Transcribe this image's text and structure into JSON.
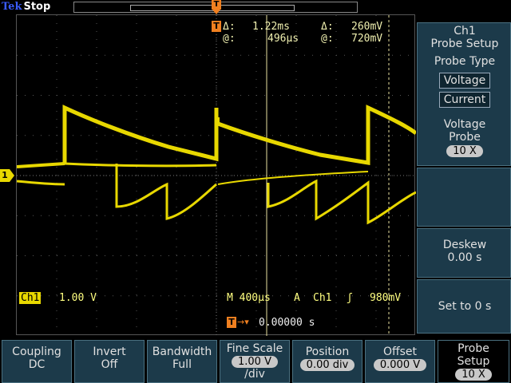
{
  "status": {
    "brand": "Tek",
    "acq_state": "Stop"
  },
  "record_view": {
    "trigger_marker": "T"
  },
  "cursor_readout": {
    "t_marker": "T",
    "time_delta_label": "Δ:",
    "time_delta": "1.22ms",
    "time_at_label": "@:",
    "time_at": "496µs",
    "volt_delta_label": "Δ:",
    "volt_delta": "260mV",
    "volt_at_label": "@:",
    "volt_at": "720mV"
  },
  "channel": {
    "marker": "1",
    "tag": "Ch1",
    "scale": "1.00 V",
    "color": "#e8d800"
  },
  "timebase": {
    "horizontal": "M 400µs",
    "trigger_mode": "A",
    "trigger_source": "Ch1",
    "slope_icon": "rising-edge-icon",
    "slope_glyph": "ʃ",
    "trigger_level": "980mV",
    "trigger_marker": "T",
    "trigger_arrow": "→▾",
    "trigger_position": "0.00000 s"
  },
  "side_menu": {
    "header": [
      "Ch1",
      "Probe Setup"
    ],
    "probe_type_label": "Probe Type",
    "probe_type_options": [
      "Voltage",
      "Current"
    ],
    "voltage_probe_label": [
      "Voltage",
      "Probe"
    ],
    "voltage_probe_value": "10 X",
    "deskew_label": "Deskew",
    "deskew_value": "0.00 s",
    "set_to_zero_label": "Set to 0 s"
  },
  "bottom_menu": [
    {
      "label": "Coupling",
      "value": "DC",
      "pill": false
    },
    {
      "label": "Invert",
      "value": "Off",
      "pill": false
    },
    {
      "label": "Bandwidth",
      "value": "Full",
      "pill": false
    },
    {
      "label": "Fine Scale",
      "value": "1.00 V",
      "value2": "/div",
      "pill": true
    },
    {
      "label": "Position",
      "value": "0.00 div",
      "pill": true
    },
    {
      "label": "Offset",
      "value": "0.000 V",
      "pill": true
    },
    {
      "label": "Probe",
      "label2": "Setup",
      "value": "10 X",
      "pill": true
    }
  ],
  "colors": {
    "trace": "#e8d800",
    "trigger": "#f08020",
    "menu_bg": "#1c3a4a",
    "readout": "#f0f0b0",
    "brand": "#3a5cff"
  }
}
